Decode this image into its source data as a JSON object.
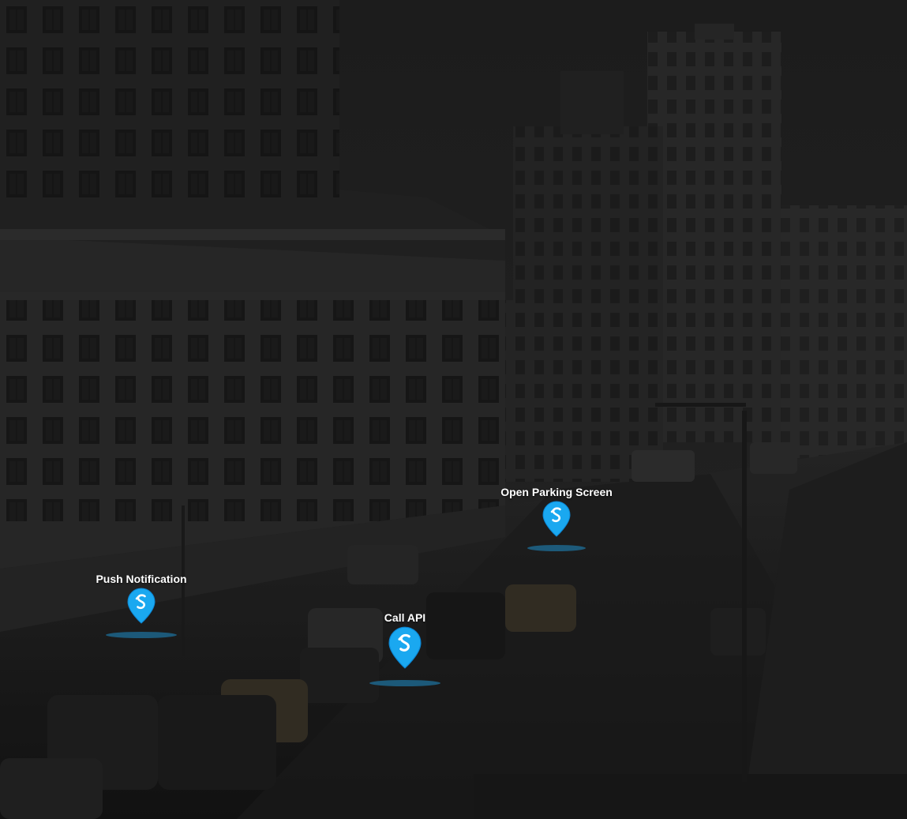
{
  "scene": {
    "background": "dark city street photograph",
    "overlay_color": "#1c1c1c"
  },
  "colors": {
    "pin_fill": "#1aa8f0",
    "pin_fill_dark": "#0b86d4",
    "pin_symbol": "#ffffff",
    "pin_shadow": "#1d6f9a"
  },
  "hotspots": [
    {
      "id": "open-parking",
      "label": "Open Parking Screen",
      "icon": "location-pin-icon"
    },
    {
      "id": "push-notification",
      "label": "Push Notification",
      "icon": "location-pin-icon"
    },
    {
      "id": "call-api",
      "label": "Call API",
      "icon": "location-pin-icon"
    }
  ]
}
